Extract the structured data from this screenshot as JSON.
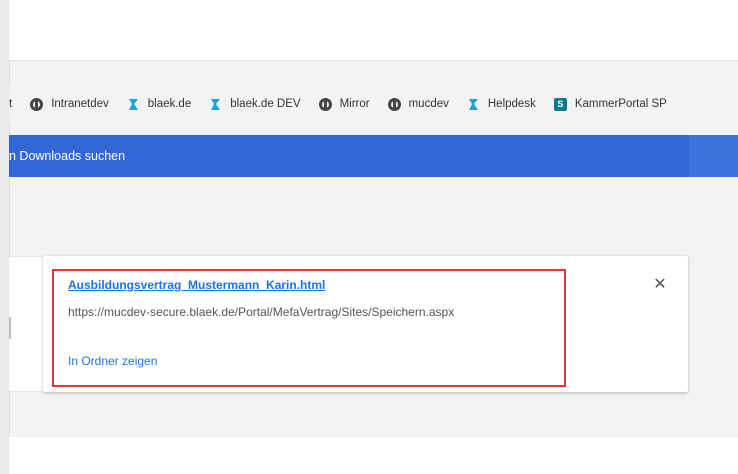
{
  "bookmarks": [
    {
      "label": "t",
      "icon": "none"
    },
    {
      "label": "Intranetdev",
      "icon": "globe-icon"
    },
    {
      "label": "blaek.de",
      "icon": "blaek-logo-icon"
    },
    {
      "label": "blaek.de DEV",
      "icon": "blaek-logo-icon"
    },
    {
      "label": "Mirror",
      "icon": "globe-icon"
    },
    {
      "label": "mucdev",
      "icon": "globe-icon"
    },
    {
      "label": "Helpdesk",
      "icon": "blaek-logo-icon"
    },
    {
      "label": "KammerPortal SP",
      "icon": "sharepoint-icon"
    }
  ],
  "search": {
    "label": "n Downloads suchen"
  },
  "download": {
    "filename": "Ausbildungsvertrag_Mustermann_Karin.html",
    "url": "https://mucdev-secure.blaek.de/Portal/MefaVertrag/Sites/Speichern.aspx",
    "show_in_folder": "In Ordner zeigen",
    "close_symbol": "✕"
  },
  "colors": {
    "accent": "#3367d6",
    "link": "#1a73e8",
    "highlight": "#e53935"
  }
}
